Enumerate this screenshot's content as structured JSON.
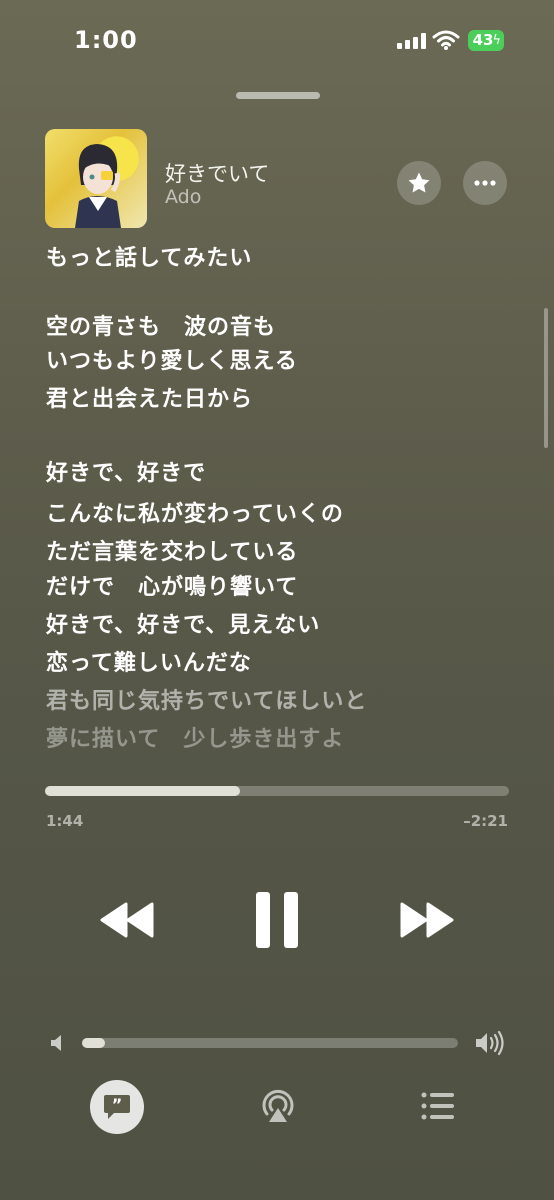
{
  "status": {
    "time": "1:00",
    "battery": "43"
  },
  "now_playing": {
    "title": "好きでいて",
    "artist": "Ado"
  },
  "lyrics": [
    "もっと話してみたい",
    "空の青さも　波の音も",
    "いつもより愛しく思える",
    "君と出会えた日から",
    "好きで、好きで",
    "こんなに私が変わっていくの",
    "ただ言葉を交わしている",
    "だけで　心が鳴り響いて",
    "好きで、好きで、見えない",
    "恋って難しいんだな",
    "君も同じ気持ちでいてほしいと",
    "夢に描いて　少し歩き出すよ"
  ],
  "playback": {
    "elapsed": "1:44",
    "remaining": "–2:21",
    "progress": 0.42
  },
  "volume": {
    "level": 0.06
  },
  "icons": [
    "star-icon",
    "more-icon",
    "rewind-icon",
    "pause-icon",
    "fast-forward-icon",
    "volume-low-icon",
    "volume-high-icon",
    "lyrics-icon",
    "airplay-icon",
    "queue-icon"
  ]
}
